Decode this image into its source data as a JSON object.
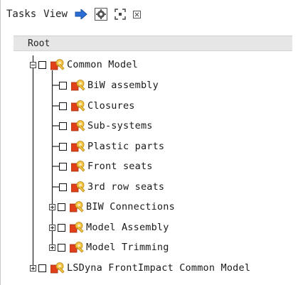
{
  "toolbar": {
    "menu_tasks": "Tasks",
    "menu_view": "View",
    "icons": [
      "arrow-right-icon",
      "settings-gear-icon",
      "fit-view-icon",
      "close-box-icon"
    ]
  },
  "tree": {
    "root_label": "Root",
    "nodes": [
      {
        "label": "Common Model",
        "expanded": true
      },
      {
        "label": "BiW assembly"
      },
      {
        "label": "Closures"
      },
      {
        "label": "Sub-systems"
      },
      {
        "label": "Plastic parts"
      },
      {
        "label": "Front seats"
      },
      {
        "label": "3rd row seats"
      },
      {
        "label": "BIW Connections",
        "expandable": true
      },
      {
        "label": "Model Assembly",
        "expandable": true
      },
      {
        "label": "Model Trimming",
        "expandable": true
      },
      {
        "label": "LSDyna FrontImpact Common Model",
        "expandable": true
      }
    ]
  },
  "colors": {
    "node_icon_red": "#e0401a",
    "node_icon_yellow": "#f5c542",
    "arrow_blue": "#2a6fd6",
    "root_bar": "#e6e6e6"
  }
}
